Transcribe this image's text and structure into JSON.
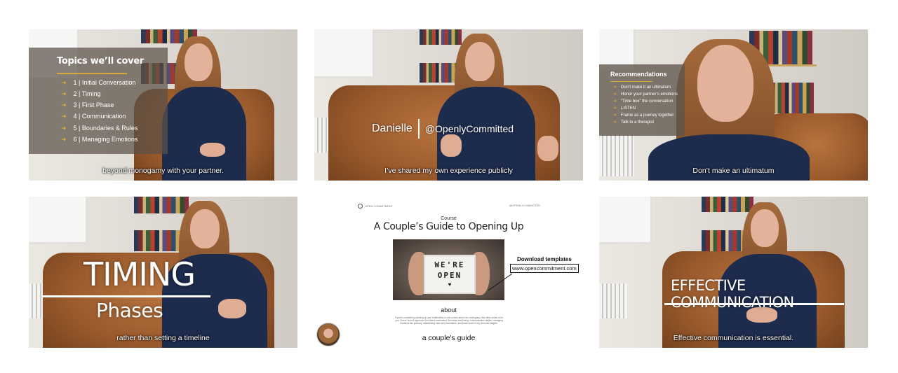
{
  "frame1": {
    "topics_title": "Topics we’ll cover",
    "topics": [
      "1 | Initial Conversation",
      "2 | Timing",
      "3 | First Phase",
      "4 | Communication",
      "5 | Boundaries & Rules",
      "6 | Managing Emotions"
    ],
    "caption": "beyond monogamy with your partner."
  },
  "frame2": {
    "name": "Danielle",
    "handle": "@OpenlyCommitted",
    "caption": "I’ve shared my own experience publicly"
  },
  "frame3": {
    "title": "Recommendations",
    "items": [
      "Don’t make it an ultimatum",
      "Honor your partner’s emotions",
      "“Time box” the conversation",
      "LISTEN",
      "Frame as a journey together",
      "Talk to a therapist"
    ],
    "caption": "Don’t make an ultimatum"
  },
  "frame4": {
    "title": "TIMING",
    "subtitle": "Phases",
    "caption": "rather than setting a timeline"
  },
  "frame5": {
    "header_left": "OPEN COMMITMENT",
    "header_right": "@OPENLYCOMMITTED",
    "eyebrow": "Course",
    "title": "A Couple’s Guide to Opening Up",
    "sign_line1": "WE'RE",
    "sign_line2": "OPEN",
    "download_label": "Download templates",
    "url": "www.opencommitment.com",
    "about_heading": "about",
    "about_text": "If you're considering opening up your relationship or are curious about non-monogamy, this video series is for you. I cover how to approach the initial conversation, first steps and timing, communication tactics, managing emotions like jealousy, establishing rules and boundaries, and share some of my personal insights.",
    "caption": "a couple's guide"
  },
  "frame6": {
    "title": "EFFECTIVE COMMUNICATION",
    "caption": "Effective communication is essential."
  },
  "colors": {
    "accent": "#d9a93a",
    "overlay": "#5a5046",
    "shirt": "#1d2b4d",
    "couch": "#9a5a2c"
  }
}
